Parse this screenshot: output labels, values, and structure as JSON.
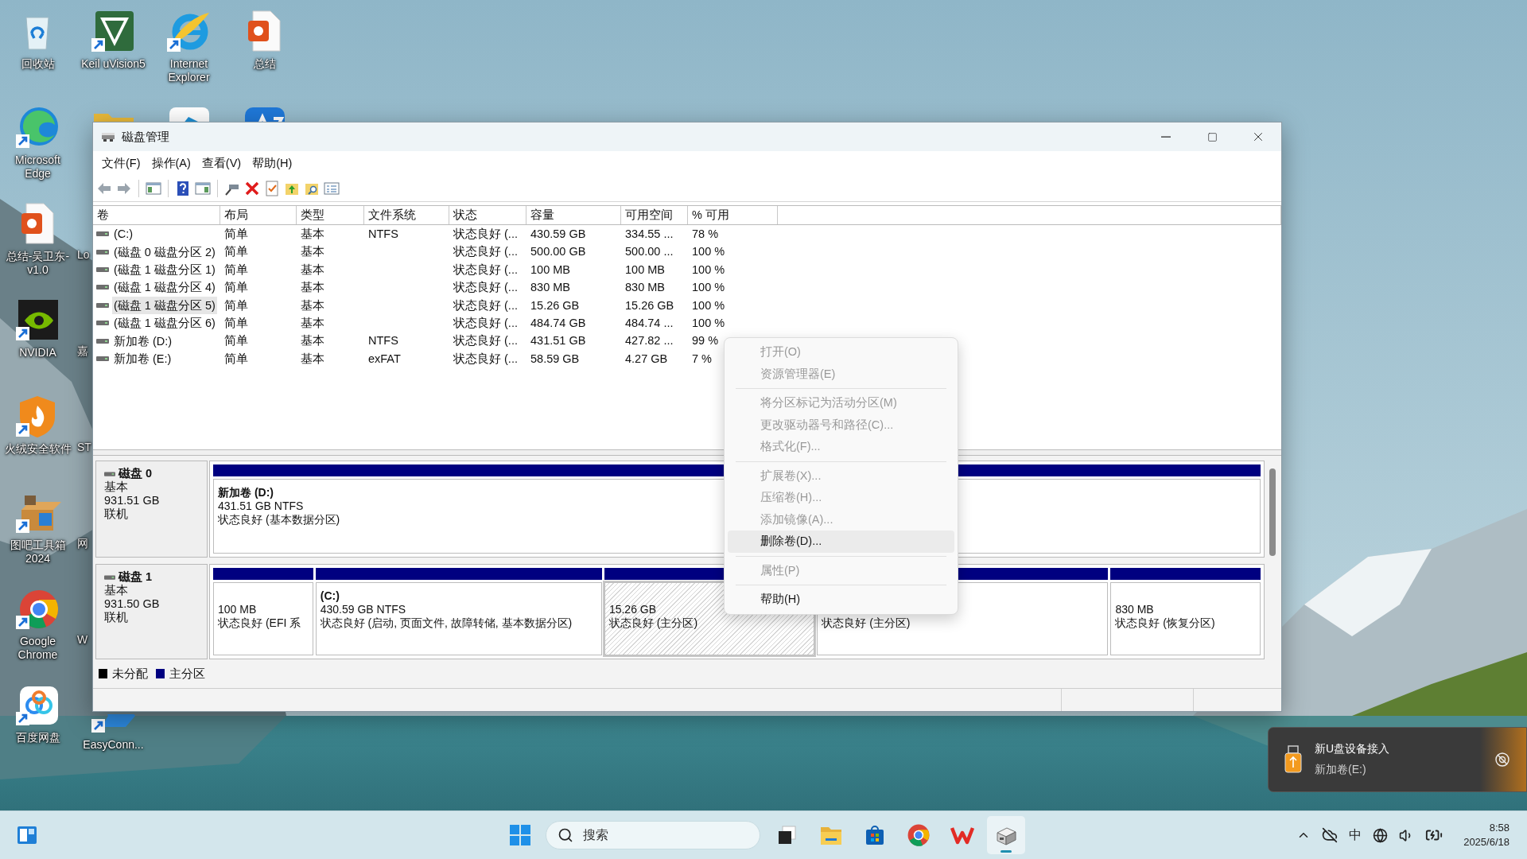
{
  "desktop_columns": [
    [
      {
        "label": "回收站",
        "kind": "recycle",
        "shortcut": false
      },
      {
        "label": "Microsoft Edge",
        "kind": "edge",
        "shortcut": true
      },
      {
        "label": "总结-吴卫东-v1.0",
        "kind": "ppt",
        "shortcut": false
      },
      {
        "label": "NVIDIA",
        "kind": "nvidia",
        "shortcut": true
      },
      {
        "label": "火绒安全软件",
        "kind": "huorong",
        "shortcut": true
      },
      {
        "label": "图吧工具箱 2024",
        "kind": "toolbox",
        "shortcut": true
      },
      {
        "label": "Google Chrome",
        "kind": "chrome",
        "shortcut": true
      },
      {
        "label": "百度网盘",
        "kind": "baidu",
        "shortcut": true
      }
    ],
    [
      {
        "label": "Keil uVision5",
        "kind": "keil",
        "shortcut": true
      },
      {
        "kind": "folder"
      },
      {
        "label": "Lo",
        "kind": "cut"
      },
      {
        "label": "嘉",
        "kind": "cut"
      },
      {
        "label": "ST",
        "kind": "cut"
      },
      {
        "label": "网",
        "kind": "cut"
      },
      {
        "label": "W",
        "kind": "cut"
      },
      {
        "label": "EasyConn...",
        "kind": "easyconn",
        "shortcut": true
      }
    ],
    [
      {
        "label": "Internet Explorer",
        "kind": "ie",
        "shortcut": true
      },
      {
        "kind": "app_blue"
      }
    ],
    [
      {
        "label": "总结",
        "kind": "ppt",
        "shortcut": false
      },
      {
        "kind": "az"
      }
    ]
  ],
  "window": {
    "title": "磁盘管理",
    "menu": [
      "文件(F)",
      "操作(A)",
      "查看(V)",
      "帮助(H)"
    ]
  },
  "table": {
    "columns": [
      "卷",
      "布局",
      "类型",
      "文件系统",
      "状态",
      "容量",
      "可用空间",
      "% 可用"
    ],
    "rows": [
      {
        "volume": "(C:)",
        "layout": "简单",
        "type": "基本",
        "filesystem": "NTFS",
        "status": "状态良好 (...",
        "capacity": "430.59 GB",
        "free": "334.55 ...",
        "percent": "78 %",
        "selected": false
      },
      {
        "volume": "(磁盘 0 磁盘分区 2)",
        "layout": "简单",
        "type": "基本",
        "status": "状态良好 (...",
        "capacity": "500.00 GB",
        "free": "500.00 ...",
        "percent": "100 %",
        "selected": false
      },
      {
        "volume": "(磁盘 1 磁盘分区 1)",
        "layout": "简单",
        "type": "基本",
        "status": "状态良好 (...",
        "capacity": "100 MB",
        "free": "100 MB",
        "percent": "100 %",
        "selected": false
      },
      {
        "volume": "(磁盘 1 磁盘分区 4)",
        "layout": "简单",
        "type": "基本",
        "status": "状态良好 (...",
        "capacity": "830 MB",
        "free": "830 MB",
        "percent": "100 %",
        "selected": false
      },
      {
        "volume": "(磁盘 1 磁盘分区 5)",
        "layout": "简单",
        "type": "基本",
        "status": "状态良好 (...",
        "capacity": "15.26 GB",
        "free": "15.26 GB",
        "percent": "100 %",
        "selected": true
      },
      {
        "volume": "(磁盘 1 磁盘分区 6)",
        "layout": "简单",
        "type": "基本",
        "status": "状态良好 (...",
        "capacity": "484.74 GB",
        "free": "484.74 ...",
        "percent": "100 %",
        "selected": false
      },
      {
        "volume": "新加卷 (D:)",
        "layout": "简单",
        "type": "基本",
        "filesystem": "NTFS",
        "status": "状态良好 (...",
        "capacity": "431.51 GB",
        "free": "427.82 ...",
        "percent": "99 %",
        "selected": false
      },
      {
        "volume": "新加卷 (E:)",
        "layout": "简单",
        "type": "基本",
        "filesystem": "exFAT",
        "status": "状态良好 (...",
        "capacity": "58.59 GB",
        "free": "4.27 GB",
        "percent": "7 %",
        "selected": false
      }
    ]
  },
  "disks": [
    {
      "name": "磁盘 0",
      "type": "基本",
      "size": "931.51 GB",
      "status": "联机",
      "partitions": [
        {
          "title": "新加卷 (D:)",
          "size": "431.51 GB NTFS",
          "status": "状态良好 (基本数据分区)",
          "selected": false
        }
      ]
    },
    {
      "name": "磁盘 1",
      "type": "基本",
      "size": "931.50 GB",
      "status": "联机",
      "partitions": [
        {
          "size": "100 MB",
          "status": "状态良好 (EFI 系",
          "selected": false
        },
        {
          "title": "(C:)",
          "size": "430.59 GB NTFS",
          "status": "状态良好 (启动, 页面文件, 故障转储, 基本数据分区)",
          "selected": false
        },
        {
          "size": "15.26 GB",
          "status": "状态良好 (主分区)",
          "selected": true
        },
        {
          "status": "状态良好 (主分区)",
          "selected": false
        },
        {
          "size": "830 MB",
          "status": "状态良好 (恢复分区)",
          "selected": false
        }
      ]
    }
  ],
  "legend": [
    {
      "label": "未分配",
      "color": "#000000"
    },
    {
      "label": "主分区",
      "color": "#000080"
    }
  ],
  "context_menu": {
    "groups": [
      [
        {
          "label": "打开(O)",
          "disabled": true,
          "selected": false
        },
        {
          "label": "资源管理器(E)",
          "disabled": true,
          "selected": false
        }
      ],
      [
        {
          "label": "将分区标记为活动分区(M)",
          "disabled": true,
          "selected": false
        },
        {
          "label": "更改驱动器号和路径(C)...",
          "disabled": true,
          "selected": false
        },
        {
          "label": "格式化(F)...",
          "disabled": true,
          "selected": false
        }
      ],
      [
        {
          "label": "扩展卷(X)...",
          "disabled": true,
          "selected": false
        },
        {
          "label": "压缩卷(H)...",
          "disabled": true,
          "selected": false
        },
        {
          "label": "添加镜像(A)...",
          "disabled": true,
          "selected": false
        },
        {
          "label": "删除卷(D)...",
          "disabled": false,
          "selected": true
        }
      ],
      [
        {
          "label": "属性(P)",
          "disabled": true,
          "selected": false
        }
      ],
      [
        {
          "label": "帮助(H)",
          "disabled": false,
          "selected": false
        }
      ]
    ]
  },
  "notification": {
    "title": "新U盘设备接入",
    "body": "新加卷(E:)"
  },
  "taskbar": {
    "search": {
      "placeholder": "搜索"
    },
    "apps": [
      {
        "kind": "taskview",
        "active": false
      },
      {
        "kind": "explorer",
        "active": false
      },
      {
        "kind": "store",
        "active": false
      },
      {
        "kind": "chrome",
        "active": false
      },
      {
        "kind": "wps",
        "active": false
      },
      {
        "kind": "diskmgmt",
        "active": true
      }
    ],
    "tray": {
      "ime": "中",
      "time": "8:58",
      "date": "2025/6/18"
    }
  }
}
